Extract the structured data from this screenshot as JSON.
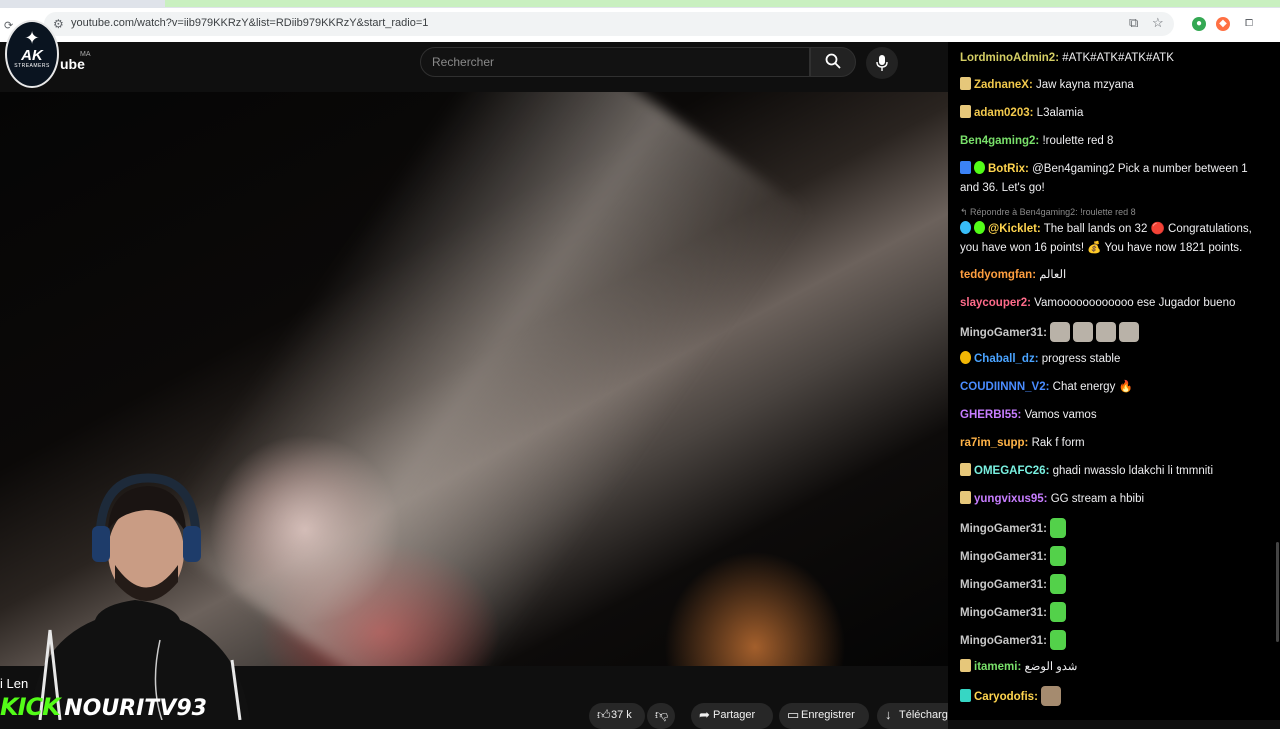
{
  "browser": {
    "url": "youtube.com/watch?v=iib979KKRzY&list=RDiib979KKRzY&start_radio=1"
  },
  "logo": {
    "title": "AK",
    "subtitle": "STREAMERS"
  },
  "youtube": {
    "wordmark": "ube",
    "country": "MA",
    "search_placeholder": "Rechercher"
  },
  "overlay": {
    "kick_label": "KICK",
    "channel_name": "NOURITV93",
    "partial_text": "i Len"
  },
  "actions": {
    "likes": "37 k",
    "share_label": "Partager",
    "save_label": "Enregistrer",
    "download_label": "Télécharg"
  },
  "chat": {
    "messages": [
      {
        "user": "LordminoAdmin2:",
        "text": "#ATK#ATK#ATK#ATK",
        "color": "#d4ce64"
      },
      {
        "user": "ZadnaneX:",
        "text": "Jaw kayna mzyana",
        "color": "#f2c94c"
      },
      {
        "user": "adam0203:",
        "text": "L3alamia",
        "color": "#f2c94c"
      },
      {
        "user": "Ben4gaming2:",
        "text": "!roulette red 8",
        "color": "#79e06a"
      },
      {
        "user": "BotRix:",
        "text": "@Ben4gaming2 Pick a number between 1 and 36. Let's go!",
        "color": "#ffd54f"
      },
      {
        "user": "@Kicklet:",
        "text": "The ball lands on 32 🔴 Congratulations, you have won 16 points! 💰 You have now 1821 points.",
        "color": "#ffd54f"
      },
      {
        "user": "teddyomgfan:",
        "text": "العالم",
        "color": "#ff9f40"
      },
      {
        "user": "slaycouper2:",
        "text": "Vamoooooooooooo ese Jugador bueno",
        "color": "#ff6b8a"
      },
      {
        "user": "MingoGamer31:",
        "text": "",
        "color": "#c7c7c7"
      },
      {
        "user": "Chaball_dz:",
        "text": "progress stable",
        "color": "#4aa3ff"
      },
      {
        "user": "COUDIINNN_V2:",
        "text": "Chat energy 🔥",
        "color": "#4a8cff"
      },
      {
        "user": "GHERBI55:",
        "text": "Vamos vamos",
        "color": "#c77dff"
      },
      {
        "user": "ra7im_supp:",
        "text": "Rak f form",
        "color": "#ffb347"
      },
      {
        "user": "OMEGAFC26:",
        "text": "ghadi nwasslo ldakchi li tmmniti",
        "color": "#79f0e0"
      },
      {
        "user": "yungvixus95:",
        "text": "GG stream a hbibi",
        "color": "#c77dff"
      },
      {
        "user": "MingoGamer31:",
        "text": "",
        "color": "#c7c7c7"
      },
      {
        "user": "MingoGamer31:",
        "text": "",
        "color": "#c7c7c7"
      },
      {
        "user": "MingoGamer31:",
        "text": "",
        "color": "#c7c7c7"
      },
      {
        "user": "MingoGamer31:",
        "text": "",
        "color": "#c7c7c7"
      },
      {
        "user": "MingoGamer31:",
        "text": "",
        "color": "#c7c7c7"
      },
      {
        "user": "itamemi:",
        "text": "شدو الوضع",
        "color": "#79e06a"
      },
      {
        "user": "Caryodofis:",
        "text": "",
        "color": "#ffd54f"
      }
    ],
    "reply_context": "Répondre à Ben4gaming2: !roulette red 8"
  },
  "icons": [
    "search-icon",
    "mic-icon",
    "like-icon",
    "dislike-icon",
    "share-icon",
    "save-icon",
    "download-icon",
    "star-icon",
    "extensions-icon"
  ]
}
